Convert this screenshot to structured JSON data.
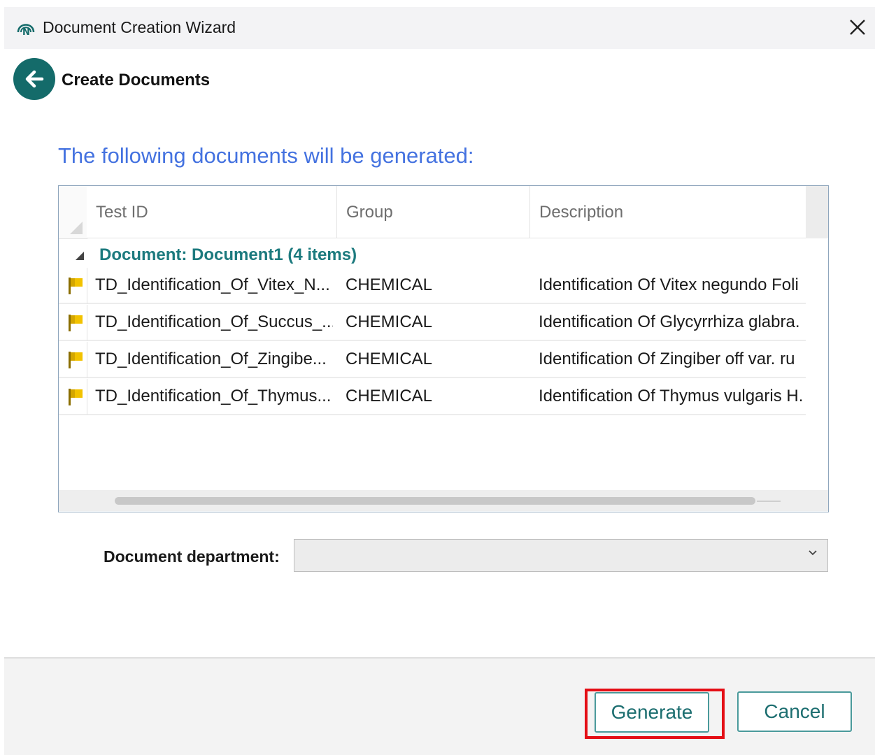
{
  "window": {
    "title": "Document Creation Wizard"
  },
  "header": {
    "title": "Create Documents"
  },
  "main": {
    "heading": "The following documents will be generated:",
    "grid": {
      "columns": [
        "Test ID",
        "Group",
        "Description"
      ],
      "group": {
        "label": "Document: Document1",
        "count": "(4 items)"
      },
      "rows": [
        {
          "test_id": "TD_Identification_Of_Vitex_N...",
          "group": "CHEMICAL",
          "description": "Identification Of Vitex negundo Foli"
        },
        {
          "test_id": "TD_Identification_Of_Succus_...",
          "group": "CHEMICAL",
          "description": "Identification Of Glycyrrhiza glabra."
        },
        {
          "test_id": "TD_Identification_Of_Zingibe...",
          "group": "CHEMICAL",
          "description": "Identification Of Zingiber off var. ru"
        },
        {
          "test_id": "TD_Identification_Of_Thymus...",
          "group": "CHEMICAL",
          "description": "Identification Of Thymus vulgaris H."
        }
      ]
    },
    "department": {
      "label": "Document department:",
      "value": ""
    }
  },
  "footer": {
    "generate_label": "Generate",
    "cancel_label": "Cancel"
  },
  "colors": {
    "accent": "#146b6a",
    "heading": "#4472e0",
    "group_text": "#1c7a7e",
    "highlight": "#e40e15",
    "flag": "#f2c200"
  }
}
